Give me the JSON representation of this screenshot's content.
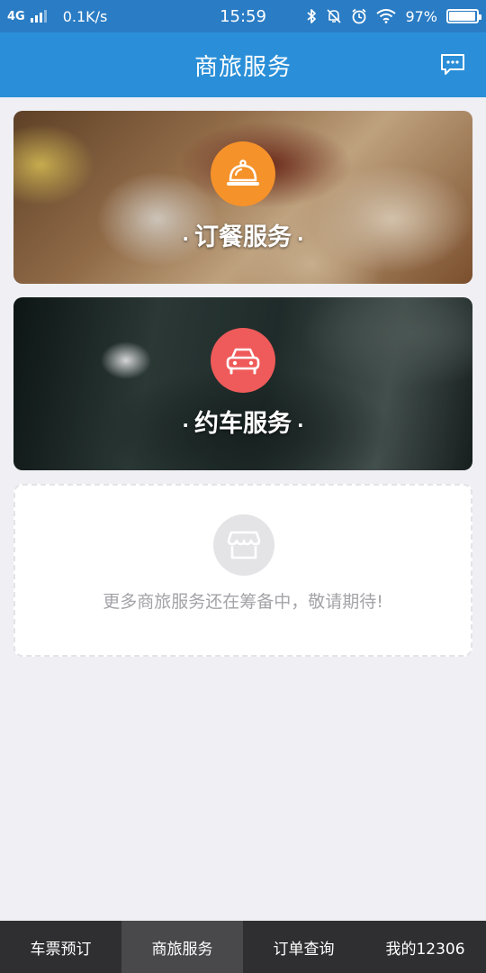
{
  "status_bar": {
    "network": "4G",
    "speed": "0.1K/s",
    "time": "15:59",
    "battery_percent": "97%",
    "battery_level": 0.97,
    "icons": [
      "signal-icon",
      "bluetooth-icon",
      "mute-notification-icon",
      "alarm-icon",
      "wifi-icon",
      "battery-icon"
    ]
  },
  "header": {
    "title": "商旅服务",
    "action_icon": "message-icon"
  },
  "services": [
    {
      "label": "订餐服务",
      "icon": "food-cloche-icon",
      "accent": "#f5922a"
    },
    {
      "label": "约车服务",
      "icon": "car-icon",
      "accent": "#ef5b5a"
    }
  ],
  "more": {
    "icon": "store-icon",
    "text": "更多商旅服务还在筹备中，敬请期待!"
  },
  "tabs": [
    {
      "label": "车票预订",
      "active": false
    },
    {
      "label": "商旅服务",
      "active": true
    },
    {
      "label": "订单查询",
      "active": false
    },
    {
      "label": "我的12306",
      "active": false
    }
  ],
  "colors": {
    "header": "#2a8fd8",
    "status_bar": "#2a7cc4",
    "tab_bar": "#2f2f31",
    "tab_active": "#49494c",
    "page_background": "#efeff4"
  },
  "separator_dot": "·"
}
